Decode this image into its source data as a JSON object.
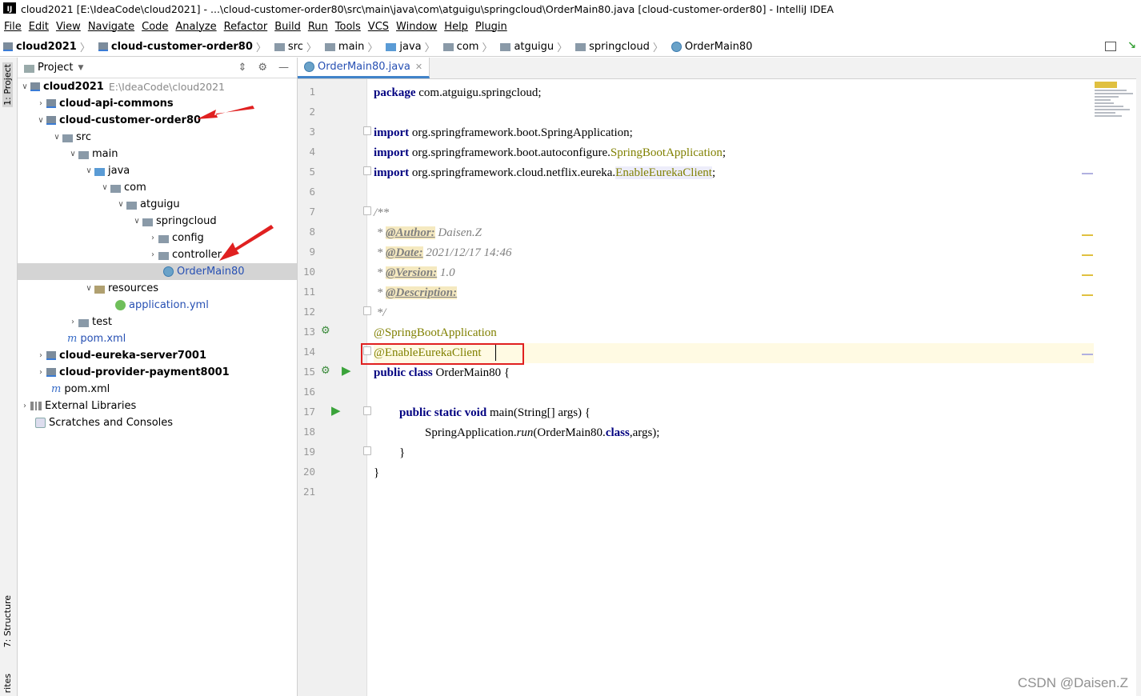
{
  "window": {
    "title": "cloud2021 [E:\\IdeaCode\\cloud2021] - ...\\cloud-customer-order80\\src\\main\\java\\com\\atguigu\\springcloud\\OrderMain80.java [cloud-customer-order80] - IntelliJ IDEA",
    "logo": "IJ"
  },
  "menu": [
    "File",
    "Edit",
    "View",
    "Navigate",
    "Code",
    "Analyze",
    "Refactor",
    "Build",
    "Run",
    "Tools",
    "VCS",
    "Window",
    "Help",
    "Plugin"
  ],
  "breadcrumb": [
    "cloud2021",
    "cloud-customer-order80",
    "src",
    "main",
    "java",
    "com",
    "atguigu",
    "springcloud",
    "OrderMain80"
  ],
  "left_strip": {
    "project_tab": "1: Project",
    "structure_tab": "7: Structure",
    "favorites_tab": "rites"
  },
  "project_panel": {
    "title": "Project",
    "tree": [
      {
        "label": "cloud2021",
        "hint": "E:\\IdeaCode\\cloud2021"
      },
      {
        "label": "cloud-api-commons"
      },
      {
        "label": "cloud-customer-order80"
      },
      {
        "label": "src"
      },
      {
        "label": "main"
      },
      {
        "label": "java"
      },
      {
        "label": "com"
      },
      {
        "label": "atguigu"
      },
      {
        "label": "springcloud"
      },
      {
        "label": "config"
      },
      {
        "label": "controller"
      },
      {
        "label": "OrderMain80"
      },
      {
        "label": "resources"
      },
      {
        "label": "application.yml"
      },
      {
        "label": "test"
      },
      {
        "label": "pom.xml"
      },
      {
        "label": "cloud-eureka-server7001"
      },
      {
        "label": "cloud-provider-payment8001"
      },
      {
        "label": "pom.xml"
      },
      {
        "label": "External Libraries"
      },
      {
        "label": "Scratches and Consoles"
      }
    ]
  },
  "editor": {
    "tab_label": "OrderMain80.java",
    "line_numbers": [
      "1",
      "2",
      "3",
      "4",
      "5",
      "6",
      "7",
      "8",
      "9",
      "10",
      "11",
      "12",
      "13",
      "14",
      "15",
      "16",
      "17",
      "18",
      "19",
      "20",
      "21"
    ],
    "code": {
      "l1_kw": "package",
      "l1_rest": " com.atguigu.springcloud;",
      "l3_kw": "import",
      "l3_rest": " org.springframework.boot.SpringApplication;",
      "l4_kw": "import",
      "l4_rest": " org.springframework.boot.autoconfigure.",
      "l4_ann": "SpringBootApplication",
      "l4_end": ";",
      "l5_kw": "import",
      "l5_rest": " org.springframework.cloud.netflix.eureka.",
      "l5_ann": "EnableEurekaClient",
      "l5_end": ";",
      "l7": "/**",
      "l8_star": " * ",
      "l8_tag": "@Author:",
      "l8_val": " Daisen.Z",
      "l9_star": " * ",
      "l9_tag": "@Date:",
      "l9_val": " 2021/12/17 14:46",
      "l10_star": " * ",
      "l10_tag": "@Version:",
      "l10_val": " 1.0",
      "l11_star": " * ",
      "l11_tag": "@Description:",
      "l12": " */",
      "l13": "@SpringBootApplication",
      "l14": "@EnableEurekaClient",
      "l15_kw": "public class",
      "l15_rest": " OrderMain80 {",
      "l17_kw": "public static void",
      "l17_rest": " main(String[] args) {",
      "l18_a": "SpringApplication.",
      "l18_run": "run",
      "l18_b": "(OrderMain80.",
      "l18_kw": "class",
      "l18_c": ",args);",
      "l19": "}",
      "l20": "}"
    }
  },
  "watermark": "CSDN @Daisen.Z",
  "colors": {
    "keyword": "#000080",
    "annotation": "#808000",
    "comment": "#808080",
    "highlight_box": "#e02020",
    "arrow": "#e02020"
  }
}
